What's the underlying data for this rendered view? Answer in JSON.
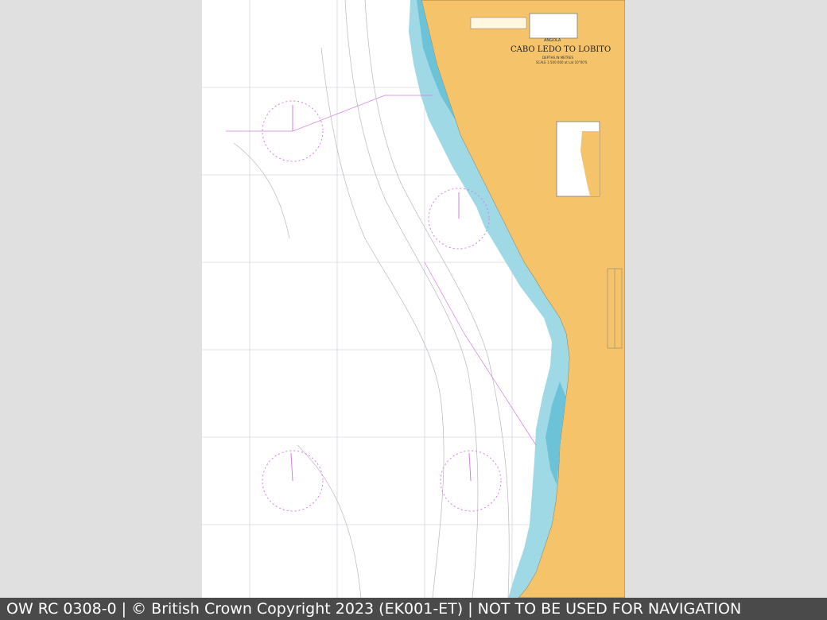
{
  "chart": {
    "country": "ANGOLA",
    "title": "CABO LEDO TO LOBITO",
    "subtitle": "DEPTHS IN METRES",
    "scale_note": "SCALE 1:500 000 at Lat 10°00'S"
  },
  "footer": {
    "text": "OW RC 0308-0 | © British Crown Copyright 2023 (EK001-ET) | NOT TO BE USED FOR NAVIGATION"
  },
  "colors": {
    "land": "#f5c46a",
    "shallow_water": "#9fd9e6",
    "deep_shallow": "#6cc2d6",
    "sea": "#ffffff",
    "compass": "#d27fe0",
    "viewer_bg": "#e0e0e0",
    "footer_bg": "#4a4a4a"
  }
}
